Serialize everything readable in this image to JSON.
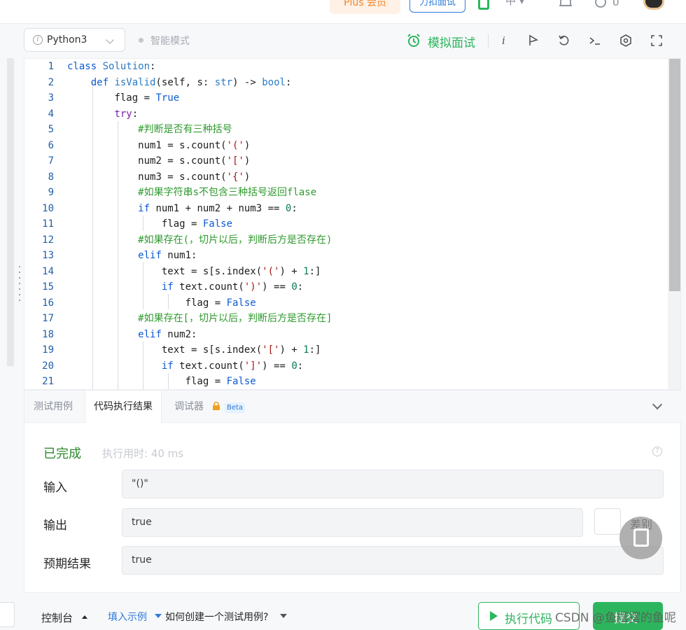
{
  "header": {
    "plus_label": "Plus 会员",
    "mock_label": "力扣面试",
    "lang_label": "中",
    "points_value": "0"
  },
  "toolbar": {
    "language": "Python3",
    "smart_mode": "智能模式",
    "mock_interview": "模拟面试",
    "info_label": "i"
  },
  "editor": {
    "lines": [
      {
        "n": "1"
      },
      {
        "n": "2"
      },
      {
        "n": "3"
      },
      {
        "n": "4"
      },
      {
        "n": "5"
      },
      {
        "n": "6"
      },
      {
        "n": "7"
      },
      {
        "n": "8"
      },
      {
        "n": "9"
      },
      {
        "n": "10"
      },
      {
        "n": "11"
      },
      {
        "n": "12"
      },
      {
        "n": "13"
      },
      {
        "n": "14"
      },
      {
        "n": "15"
      },
      {
        "n": "16"
      },
      {
        "n": "17"
      },
      {
        "n": "18"
      },
      {
        "n": "19"
      },
      {
        "n": "20"
      },
      {
        "n": "21"
      }
    ],
    "code": {
      "l1_kw": "class",
      "l1_name": "Solution",
      "l1_rest": ":",
      "l2_kw": "def",
      "l2_fn": "isValid",
      "l2_a": "(self, s: ",
      "l2_t1": "str",
      "l2_b": ") -> ",
      "l2_t2": "bool",
      "l2_c": ":",
      "l3_a": "flag = ",
      "l3_v": "True",
      "l4_kw": "try",
      "l4_c": ":",
      "l5": "#判断是否有三种括号",
      "l6_a": "num1 = s.count(",
      "l6_s": "'('",
      "l6_b": ")",
      "l7_a": "num2 = s.count(",
      "l7_s": "'['",
      "l7_b": ")",
      "l8_a": "num3 = s.count(",
      "l8_s": "'{'",
      "l8_b": ")",
      "l9": "#如果字符串s不包含三种括号返回flase",
      "l10_kw": "if",
      "l10_a": " num1 + num2 + num3 == ",
      "l10_n": "0",
      "l10_b": ":",
      "l11_a": "flag = ",
      "l11_v": "False",
      "l12": "#如果存在(，切片以后，判断后方是否存在)",
      "l13_kw": "elif",
      "l13_a": " num1:",
      "l14_a": "text = s[s.index(",
      "l14_s": "'('",
      "l14_b": ") + ",
      "l14_n": "1",
      "l14_c": ":]",
      "l15_kw": "if",
      "l15_a": " text.count(",
      "l15_s": "')'",
      "l15_b": ") == ",
      "l15_n": "0",
      "l15_c": ":",
      "l16_a": "flag = ",
      "l16_v": "False",
      "l17": "#如果存在[，切片以后，判断后方是否存在]",
      "l18_kw": "elif",
      "l18_a": " num2:",
      "l19_a": "text = s[s.index(",
      "l19_s": "'['",
      "l19_b": ") + ",
      "l19_n": "1",
      "l19_c": ":]",
      "l20_kw": "if",
      "l20_a": " text.count(",
      "l20_s": "']'",
      "l20_b": ") == ",
      "l20_n": "0",
      "l20_c": ":",
      "l21_a": "flag = ",
      "l21_v": "False"
    }
  },
  "results": {
    "tabs": [
      {
        "label": "测试用例"
      },
      {
        "label": "代码执行结果"
      },
      {
        "label": "调试器"
      }
    ],
    "beta": "Beta",
    "status": "已完成",
    "exec_time": "执行用时: 40 ms",
    "help": "?",
    "input_label": "输入",
    "input_value": "\"()\"",
    "output_label": "输出",
    "output_value": "true",
    "diff_label": "差别",
    "expected_label": "预期结果",
    "expected_value": "true"
  },
  "bottom": {
    "console": "控制台",
    "fill_example": "填入示例",
    "how_to": "如何创建一个测试用例?",
    "run": "执行代码",
    "submit": "提交",
    "watermark": "CSDN @鱼摆摆的鱼呢"
  },
  "colors": {
    "accent_green": "#2db55d",
    "link_blue": "#2f7bd8",
    "plus_orange": "#f0842b",
    "status_green": "#2d8a2d"
  }
}
